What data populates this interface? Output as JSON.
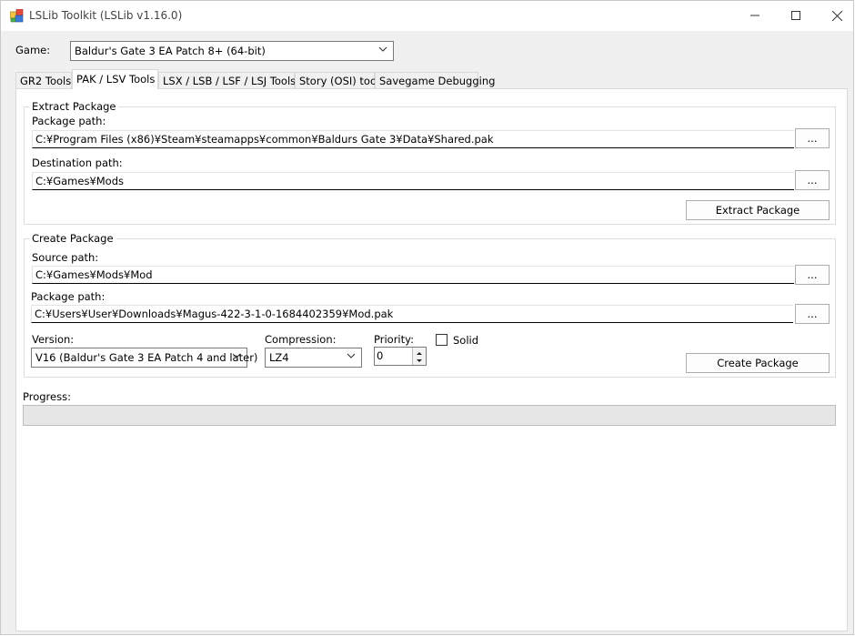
{
  "window": {
    "title": "LSLib Toolkit (LSLib v1.16.0)",
    "controls": {
      "minimize_icon": "minimize-icon",
      "maximize_icon": "maximize-icon",
      "close_icon": "close-icon"
    }
  },
  "game": {
    "label": "Game:",
    "selected": "Baldur's Gate 3 EA Patch 8+ (64-bit)"
  },
  "tabs": [
    {
      "label": "GR2 Tools"
    },
    {
      "label": "PAK / LSV Tools",
      "active": true
    },
    {
      "label": "LSX / LSB / LSF / LSJ Tools"
    },
    {
      "label": "Story (OSI) tools"
    },
    {
      "label": "Savegame Debugging"
    }
  ],
  "extract": {
    "group_title": "Extract Package",
    "package_path_label": "Package path:",
    "package_path": "C:¥Program Files (x86)¥Steam¥steamapps¥common¥Baldurs Gate 3¥Data¥Shared.pak",
    "destination_path_label": "Destination path:",
    "destination_path": "C:¥Games¥Mods",
    "browse_label": "...",
    "extract_button": "Extract Package"
  },
  "create": {
    "group_title": "Create Package",
    "source_path_label": "Source path:",
    "source_path": "C:¥Games¥Mods¥Mod",
    "package_path_label": "Package path:",
    "package_path": "C:¥Users¥User¥Downloads¥Magus-422-3-1-0-1684402359¥Mod.pak",
    "browse_label": "...",
    "version_label": "Version:",
    "version_selected": "V16 (Baldur's Gate 3 EA Patch 4 and later)",
    "compression_label": "Compression:",
    "compression_selected": "LZ4",
    "priority_label": "Priority:",
    "priority_value": "0",
    "solid_label": "Solid",
    "solid_checked": false,
    "create_button": "Create Package"
  },
  "progress": {
    "label": "Progress:",
    "value": 0
  }
}
